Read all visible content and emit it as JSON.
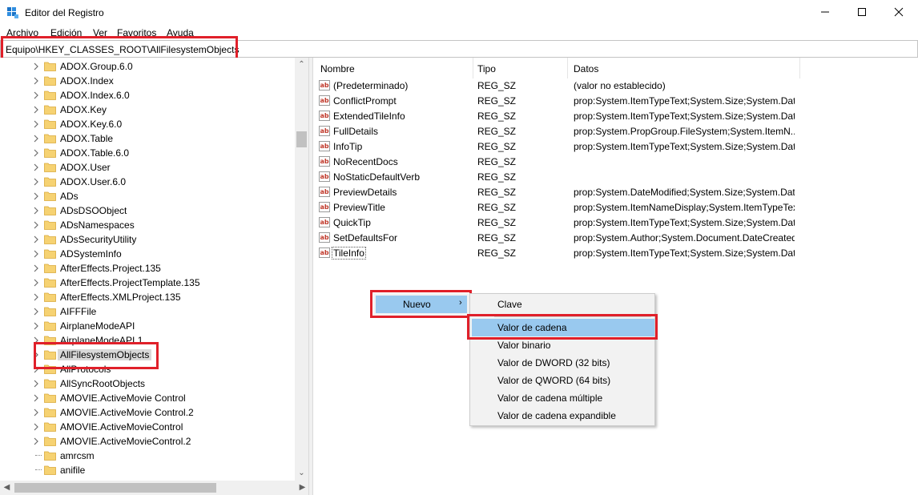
{
  "window": {
    "title": "Editor del Registro",
    "accent": "#1a73c7"
  },
  "menubar": [
    "Archivo",
    "Edición",
    "Ver",
    "Favoritos",
    "Ayuda"
  ],
  "address": {
    "path": "Equipo\\HKEY_CLASSES_ROOT\\AllFilesystemObjects"
  },
  "tree": {
    "items": [
      "ADOX.Group.6.0",
      "ADOX.Index",
      "ADOX.Index.6.0",
      "ADOX.Key",
      "ADOX.Key.6.0",
      "ADOX.Table",
      "ADOX.Table.6.0",
      "ADOX.User",
      "ADOX.User.6.0",
      "ADs",
      "ADsDSOObject",
      "ADsNamespaces",
      "ADsSecurityUtility",
      "ADSystemInfo",
      "AfterEffects.Project.135",
      "AfterEffects.ProjectTemplate.135",
      "AfterEffects.XMLProject.135",
      "AIFFFile",
      "AirplaneModeAPI",
      "AirplaneModeAPI.1",
      "AllFilesystemObjects",
      "AllProtocols",
      "AllSyncRootObjects",
      "AMOVIE.ActiveMovie Control",
      "AMOVIE.ActiveMovie Control.2",
      "AMOVIE.ActiveMovieControl",
      "AMOVIE.ActiveMovieControl.2",
      "amrcsm",
      "anifile"
    ],
    "selected_index": 20
  },
  "values": {
    "columns": {
      "name": "Nombre",
      "type": "Tipo",
      "data": "Datos"
    },
    "rows": [
      {
        "name": "(Predeterminado)",
        "type": "REG_SZ",
        "data": "(valor no establecido)"
      },
      {
        "name": "ConflictPrompt",
        "type": "REG_SZ",
        "data": "prop:System.ItemTypeText;System.Size;System.Dat..."
      },
      {
        "name": "ExtendedTileInfo",
        "type": "REG_SZ",
        "data": "prop:System.ItemTypeText;System.Size;System.Dat..."
      },
      {
        "name": "FullDetails",
        "type": "REG_SZ",
        "data": "prop:System.PropGroup.FileSystem;System.ItemN..."
      },
      {
        "name": "InfoTip",
        "type": "REG_SZ",
        "data": "prop:System.ItemTypeText;System.Size;System.Dat..."
      },
      {
        "name": "NoRecentDocs",
        "type": "REG_SZ",
        "data": ""
      },
      {
        "name": "NoStaticDefaultVerb",
        "type": "REG_SZ",
        "data": ""
      },
      {
        "name": "PreviewDetails",
        "type": "REG_SZ",
        "data": "prop:System.DateModified;System.Size;System.Dat..."
      },
      {
        "name": "PreviewTitle",
        "type": "REG_SZ",
        "data": "prop:System.ItemNameDisplay;System.ItemTypeText"
      },
      {
        "name": "QuickTip",
        "type": "REG_SZ",
        "data": "prop:System.ItemTypeText;System.Size;System.Dat..."
      },
      {
        "name": "SetDefaultsFor",
        "type": "REG_SZ",
        "data": "prop:System.Author;System.Document.DateCreated"
      },
      {
        "name": "TileInfo",
        "type": "REG_SZ",
        "data": "prop:System.ItemTypeText;System.Size;System.Dat..."
      }
    ],
    "icon_text": "ab"
  },
  "context_menu": {
    "parent_label": "Nuevo",
    "submenu": [
      "Clave",
      "Valor de cadena",
      "Valor binario",
      "Valor de DWORD (32 bits)",
      "Valor de QWORD (64 bits)",
      "Valor de cadena múltiple",
      "Valor de cadena expandible"
    ],
    "hover_index": 1
  },
  "colors": {
    "highlight_red": "#e0202a",
    "menu_hover": "#99c9ef",
    "folder_yellow": "#f6d272"
  }
}
